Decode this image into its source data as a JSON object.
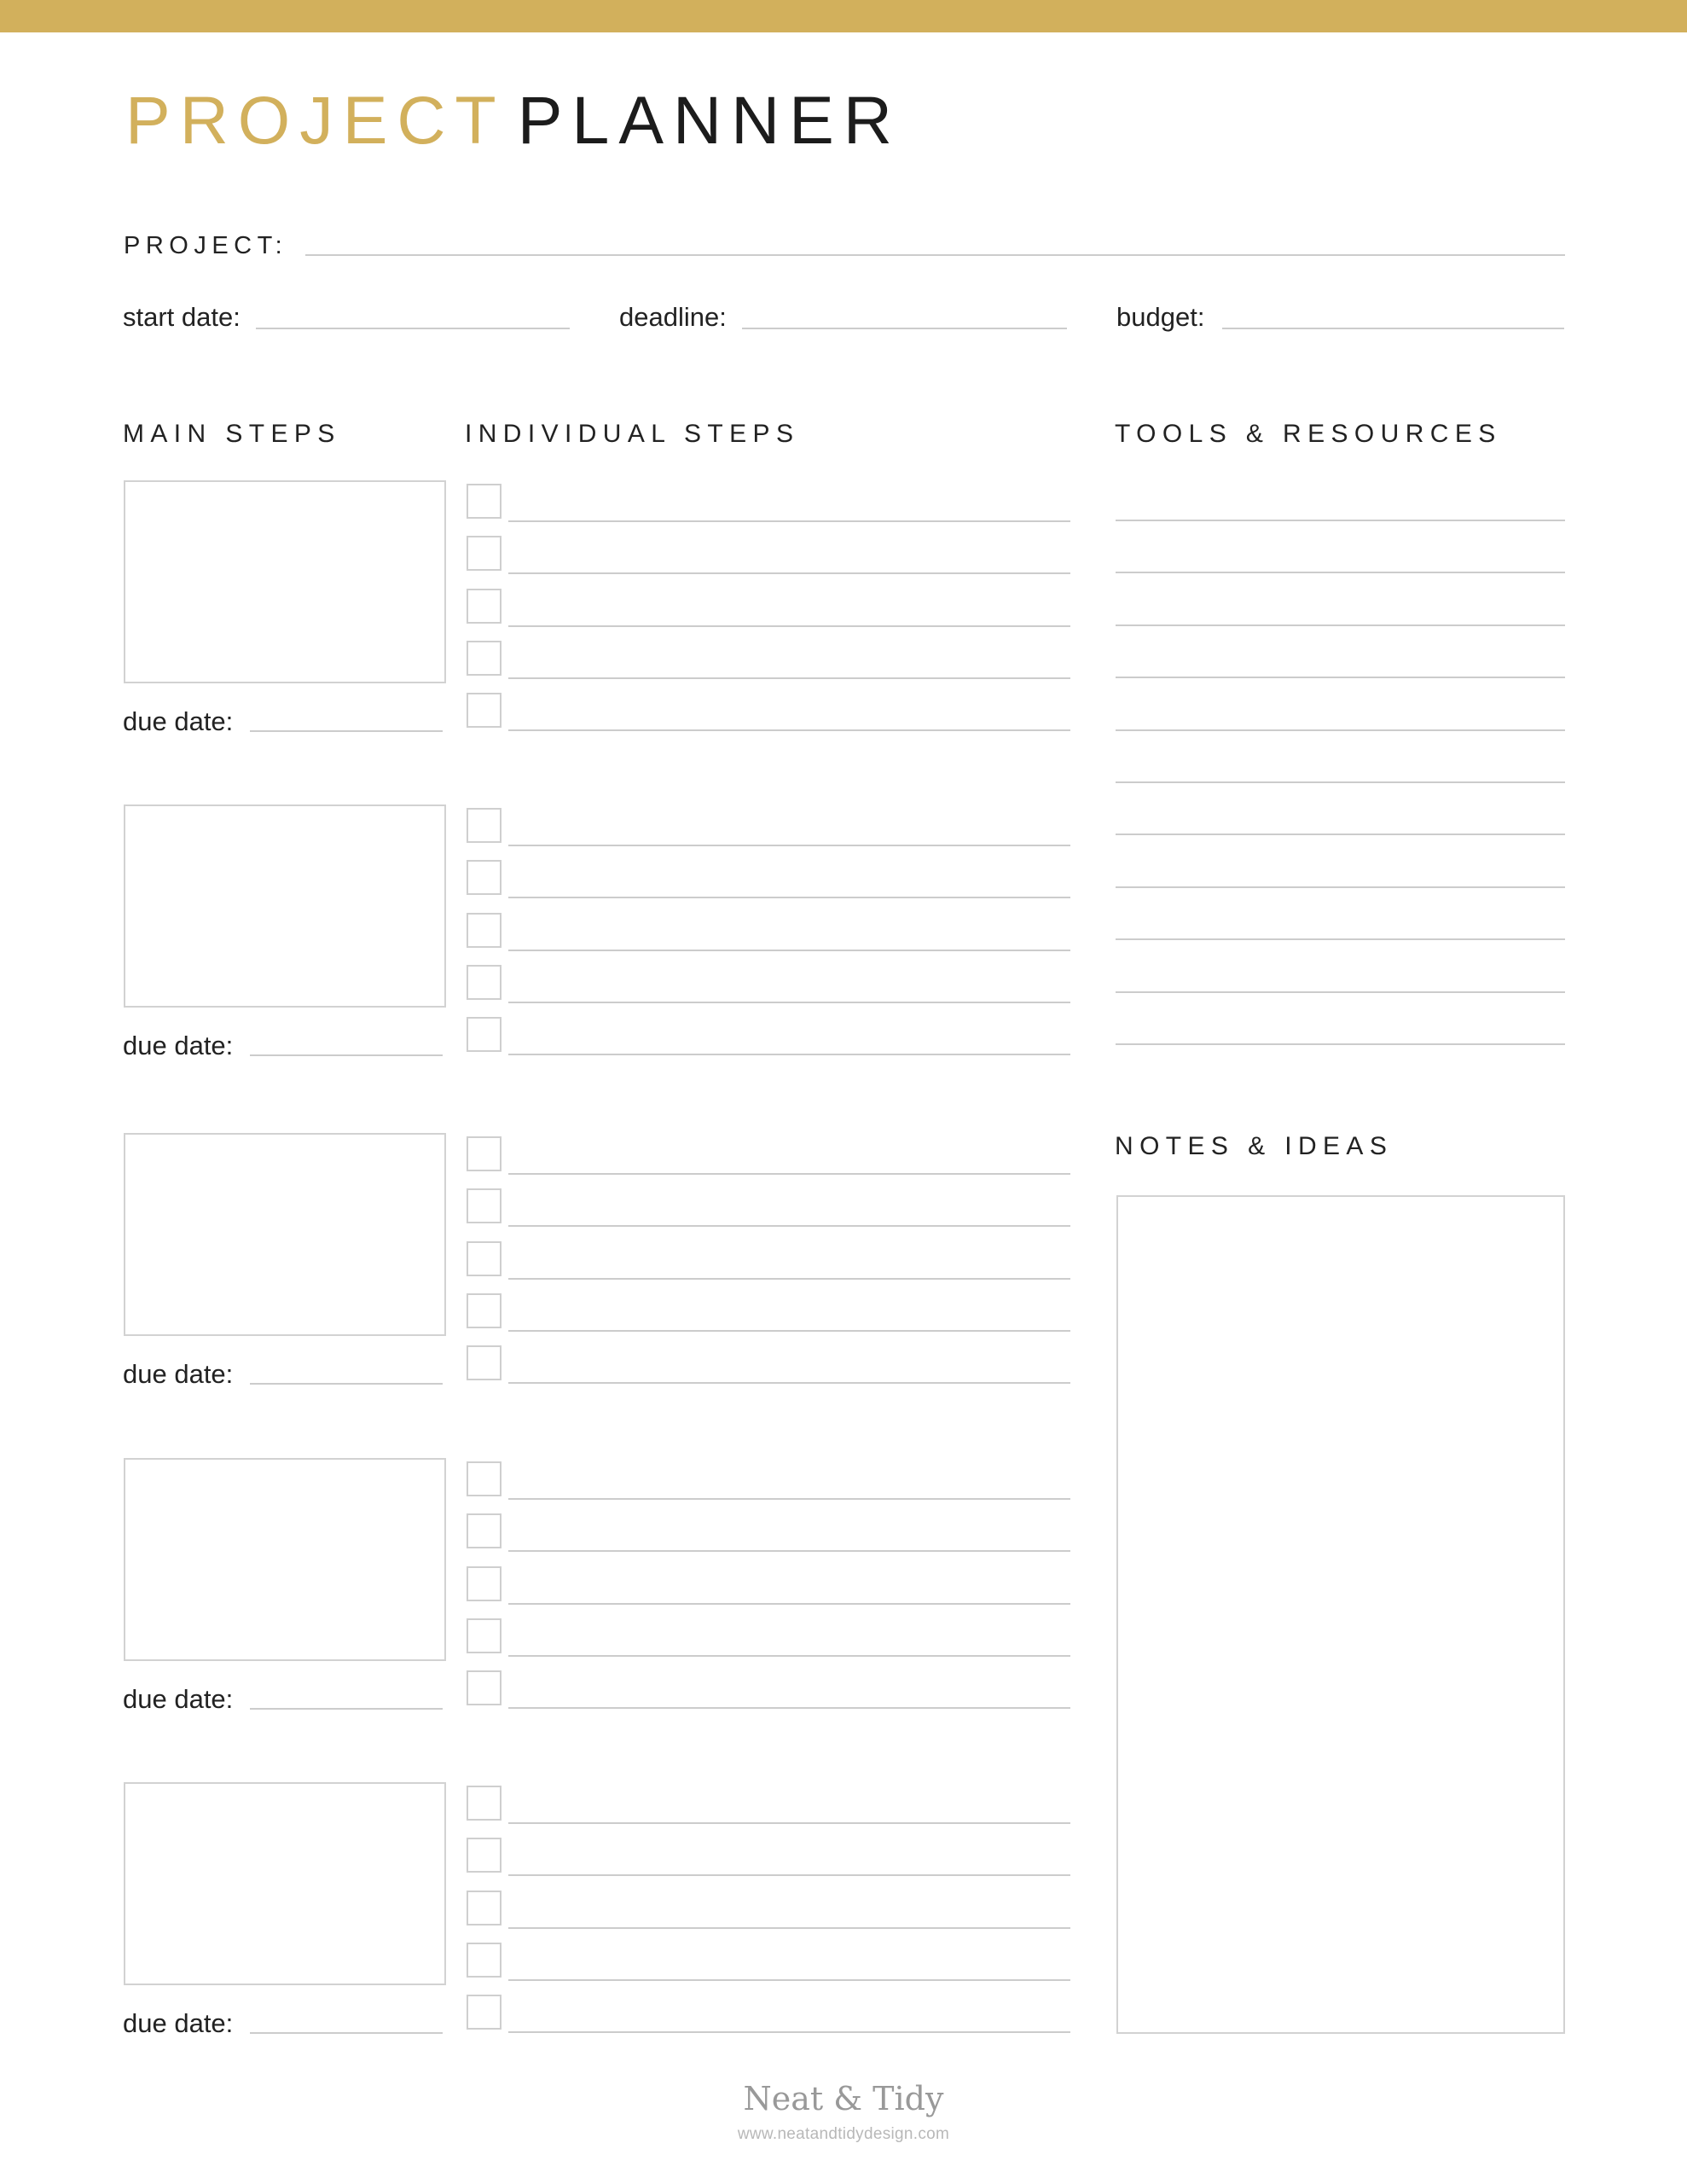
{
  "header": {
    "title_word_1": "PROJECT",
    "title_word_2": "PLANNER",
    "accent_color": "#D2B05C"
  },
  "project": {
    "label": "PROJECT:",
    "value": ""
  },
  "meta_fields": [
    {
      "label": "start date:",
      "value": ""
    },
    {
      "label": "deadline:",
      "value": ""
    },
    {
      "label": "budget:",
      "value": ""
    }
  ],
  "sections": {
    "main_steps": "MAIN STEPS",
    "individual_steps": "INDIVIDUAL STEPS",
    "tools_resources": "TOOLS & RESOURCES",
    "notes_ideas": "NOTES & IDEAS"
  },
  "main_steps": [
    {
      "text": "",
      "due_date_label": "due date:",
      "due_date": "",
      "steps": [
        {
          "checked": false,
          "text": ""
        },
        {
          "checked": false,
          "text": ""
        },
        {
          "checked": false,
          "text": ""
        },
        {
          "checked": false,
          "text": ""
        },
        {
          "checked": false,
          "text": ""
        }
      ]
    },
    {
      "text": "",
      "due_date_label": "due date:",
      "due_date": "",
      "steps": [
        {
          "checked": false,
          "text": ""
        },
        {
          "checked": false,
          "text": ""
        },
        {
          "checked": false,
          "text": ""
        },
        {
          "checked": false,
          "text": ""
        },
        {
          "checked": false,
          "text": ""
        }
      ]
    },
    {
      "text": "",
      "due_date_label": "due date:",
      "due_date": "",
      "steps": [
        {
          "checked": false,
          "text": ""
        },
        {
          "checked": false,
          "text": ""
        },
        {
          "checked": false,
          "text": ""
        },
        {
          "checked": false,
          "text": ""
        },
        {
          "checked": false,
          "text": ""
        }
      ]
    },
    {
      "text": "",
      "due_date_label": "due date:",
      "due_date": "",
      "steps": [
        {
          "checked": false,
          "text": ""
        },
        {
          "checked": false,
          "text": ""
        },
        {
          "checked": false,
          "text": ""
        },
        {
          "checked": false,
          "text": ""
        },
        {
          "checked": false,
          "text": ""
        }
      ]
    },
    {
      "text": "",
      "due_date_label": "due date:",
      "due_date": "",
      "steps": [
        {
          "checked": false,
          "text": ""
        },
        {
          "checked": false,
          "text": ""
        },
        {
          "checked": false,
          "text": ""
        },
        {
          "checked": false,
          "text": ""
        },
        {
          "checked": false,
          "text": ""
        }
      ]
    }
  ],
  "tools_resources": [
    "",
    "",
    "",
    "",
    "",
    "",
    "",
    "",
    "",
    "",
    ""
  ],
  "notes": "",
  "footer": {
    "brand": "Neat & Tidy",
    "url": "www.neatandtidydesign.com"
  }
}
